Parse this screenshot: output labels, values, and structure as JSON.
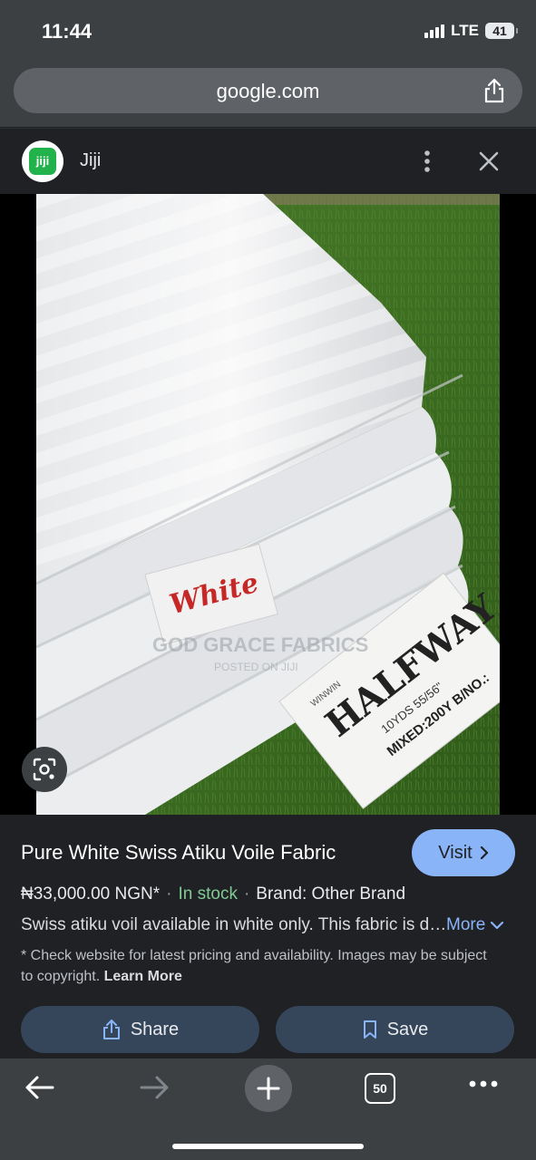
{
  "status_bar": {
    "time": "11:44",
    "network": "LTE",
    "battery": "41"
  },
  "browser": {
    "url": "google.com",
    "icons": {
      "share": "share-icon"
    }
  },
  "site": {
    "logo_text": "jiji",
    "name": "Jiji",
    "icons": [
      "more-vert-icon",
      "close-icon"
    ]
  },
  "image": {
    "watermark": "GOD GRACE FABRICS",
    "watermark_sub": "POSTED ON JIJI",
    "tag_text": "White",
    "label_brand": "HALFWAY",
    "label_maker": "WINWIN",
    "label_line1": "10YDS  55/56\"",
    "label_line2": "MIXED:200Y  B/NO.:",
    "lens_icon": "google-lens-icon"
  },
  "listing": {
    "title": "Pure White Swiss Atiku Voile Fabric",
    "visit_label": "Visit",
    "price": "₦33,000.00 NGN*",
    "stock": "In stock",
    "brand": "Brand: Other Brand",
    "description": "Swiss atiku voil available in white only. This fabric is durable and comfortable",
    "more_label": "More",
    "notice": "* Check website for latest pricing and availability. Images may be subject to copyright.",
    "learn_more": "Learn More",
    "share_label": "Share",
    "save_label": "Save",
    "accent_color": "#8ab4f8",
    "stock_color": "#81c995"
  },
  "toolbar": {
    "tab_count": "50",
    "icons": [
      "back-arrow-icon",
      "forward-arrow-icon",
      "new-tab-plus-icon",
      "tab-switcher-icon",
      "more-horiz-icon"
    ]
  }
}
